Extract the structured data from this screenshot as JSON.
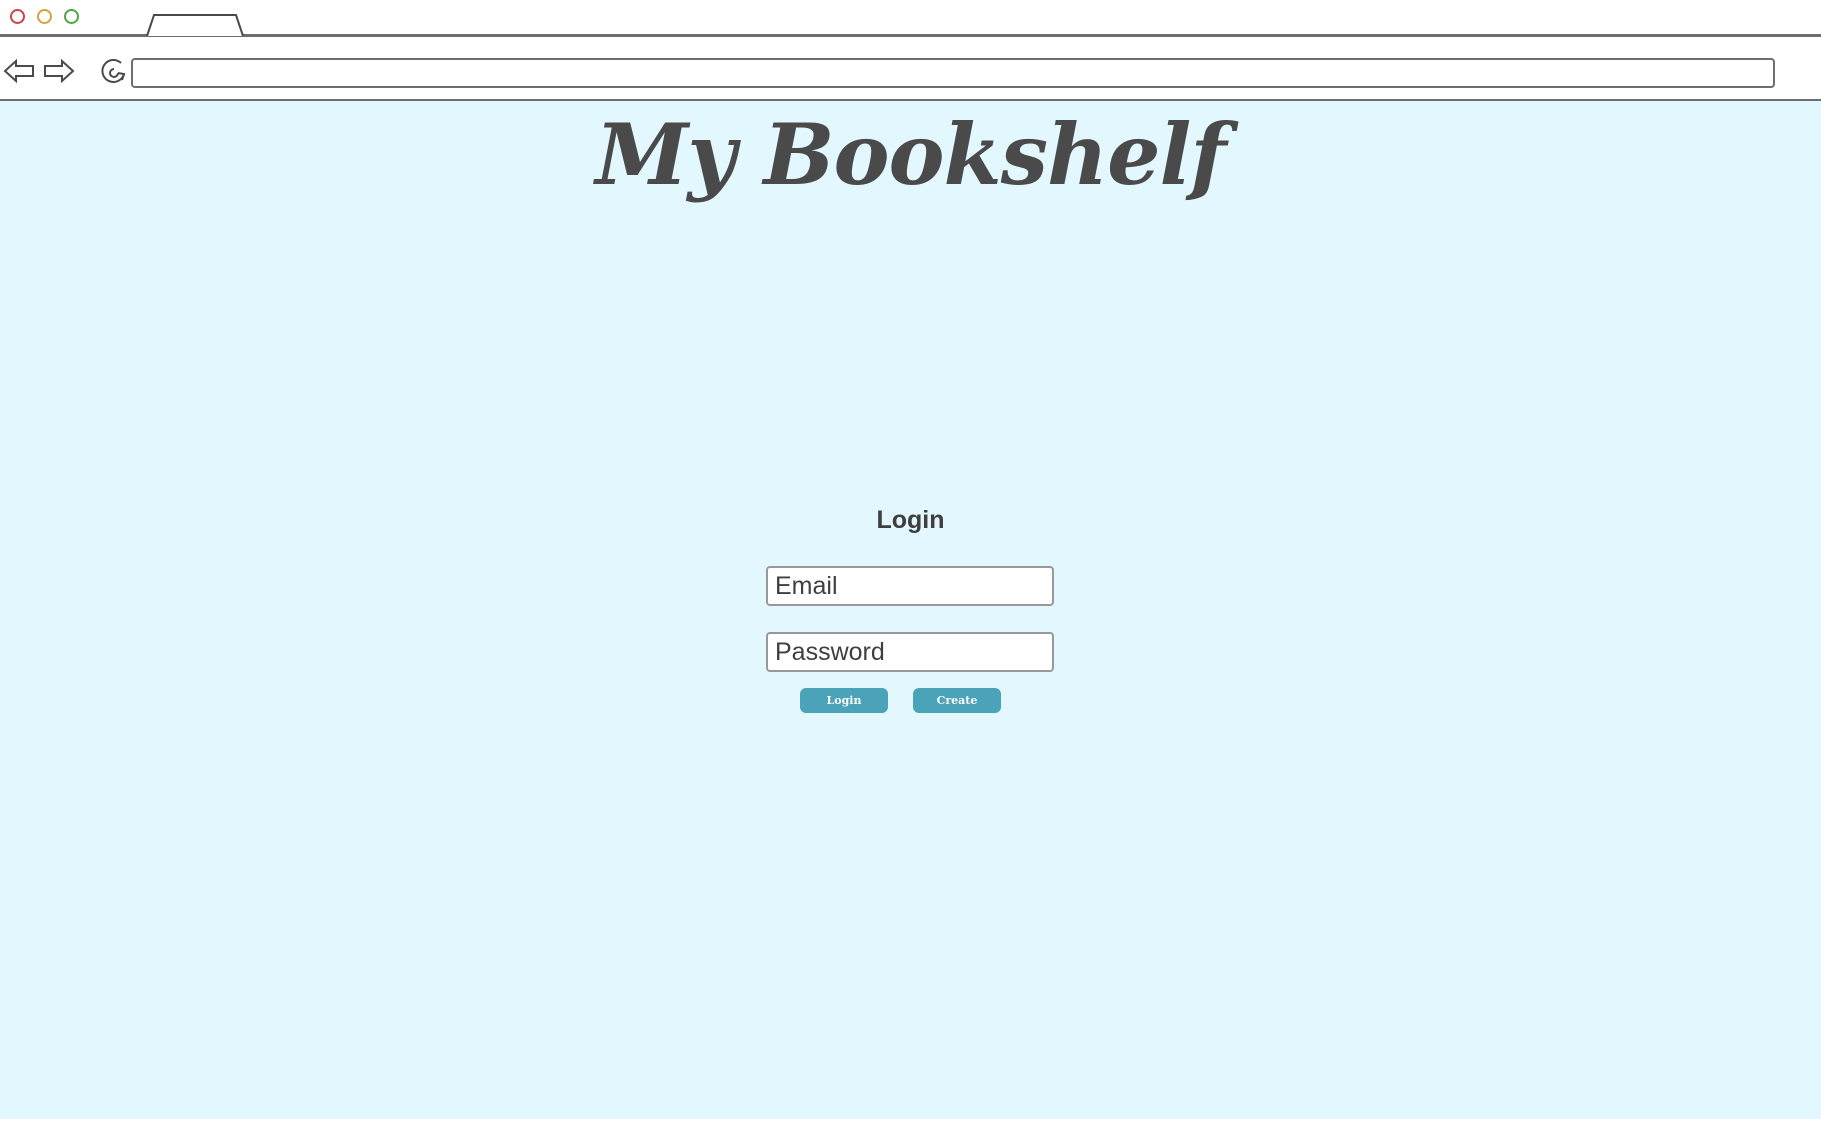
{
  "window": {
    "traffic_lights": [
      {
        "name": "close",
        "color": "#c9434d"
      },
      {
        "name": "minimize",
        "color": "#d6a23a"
      },
      {
        "name": "maximize",
        "color": "#4aa84a"
      }
    ],
    "tab_label": ""
  },
  "toolbar": {
    "back_icon": "back-arrow-icon",
    "forward_icon": "forward-arrow-icon",
    "reload_icon": "reload-icon",
    "address_value": ""
  },
  "page": {
    "background": "#e2f8fe",
    "logo_text": "My Bookshelf",
    "login_heading": "Login",
    "email_placeholder": "Email",
    "password_placeholder": "Password",
    "login_button": "Login",
    "create_button": "Create",
    "button_color": "#4aa3b8"
  }
}
